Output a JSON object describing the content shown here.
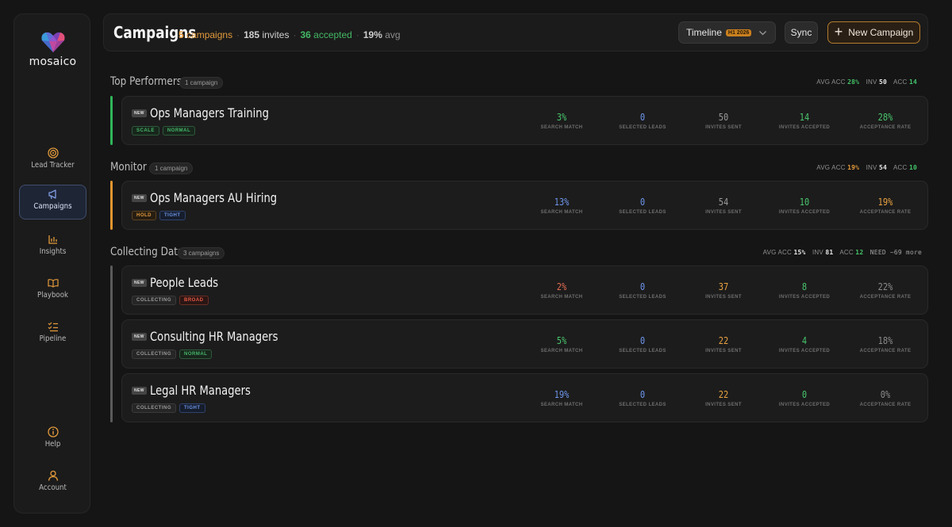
{
  "app": {
    "name": "mosaico"
  },
  "sidebar": {
    "items": [
      {
        "id": "lead-tracker",
        "label": "Lead Tracker",
        "icon": "target-icon",
        "active": false
      },
      {
        "id": "campaigns",
        "label": "Campaigns",
        "icon": "megaphone-icon",
        "active": true
      },
      {
        "id": "insights",
        "label": "Insights",
        "icon": "bar-chart-icon",
        "active": false
      },
      {
        "id": "playbook",
        "label": "Playbook",
        "icon": "book-icon",
        "active": false
      },
      {
        "id": "pipeline",
        "label": "Pipeline",
        "icon": "checklist-icon",
        "active": false
      },
      {
        "id": "help",
        "label": "Help",
        "icon": "info-icon",
        "active": false
      },
      {
        "id": "account",
        "label": "Account",
        "icon": "user-icon",
        "active": false
      }
    ]
  },
  "header": {
    "title": "Campaigns",
    "campaigns_num": "5",
    "campaigns_word": "campaigns",
    "invites_num": "185",
    "invites_word": "invites",
    "accepted_num": "36",
    "accepted_word": "accepted",
    "avg_num": "19%",
    "avg_word": "avg",
    "timeline_label": "Timeline",
    "timeline_badge": "H1 2026",
    "sync_label": "Sync",
    "new_campaign_label": "New Campaign"
  },
  "metric_captions": {
    "search_match": "SEARCH MATCH",
    "selected_leads": "SELECTED LEADS",
    "invites_sent": "INVITES SENT",
    "invites_accepted": "INVITES ACCEPTED",
    "acceptance_rate": "ACCEPTANCE RATE"
  },
  "sections": [
    {
      "title": "Top Performers",
      "pill": "1 campaign",
      "summary": {
        "avg_acc_label": "AVG ACC",
        "avg_acc": "28%",
        "inv_label": "INV",
        "inv": "50",
        "acc_label": "ACC",
        "acc": "14"
      },
      "campaigns": [
        {
          "badge": "NEW",
          "name": "Ops Managers Training",
          "tags": [
            "SCALE",
            "NORMAL"
          ],
          "search_match": "3%",
          "selected_leads": "0",
          "invites_sent": "50",
          "invites_accepted": "14",
          "acceptance_rate": "28%"
        }
      ]
    },
    {
      "title": "Monitor",
      "pill": "1 campaign",
      "summary": {
        "avg_acc_label": "AVG ACC",
        "avg_acc": "19%",
        "inv_label": "INV",
        "inv": "54",
        "acc_label": "ACC",
        "acc": "10"
      },
      "campaigns": [
        {
          "badge": "NEW",
          "name": "Ops Managers AU Hiring",
          "tags": [
            "HOLD",
            "TIGHT"
          ],
          "search_match": "13%",
          "selected_leads": "0",
          "invites_sent": "54",
          "invites_accepted": "10",
          "acceptance_rate": "19%"
        }
      ]
    },
    {
      "title": "Collecting Data",
      "pill": "3 campaigns",
      "summary": {
        "avg_acc_label": "AVG ACC",
        "avg_acc": "15%",
        "inv_label": "INV",
        "inv": "81",
        "acc_label": "ACC",
        "acc": "12",
        "need": "NEED ~69 more"
      },
      "campaigns": [
        {
          "badge": "NEW",
          "name": "People Leads",
          "tags": [
            "COLLECTING",
            "BROAD"
          ],
          "search_match": "2%",
          "selected_leads": "0",
          "invites_sent": "37",
          "invites_accepted": "8",
          "acceptance_rate": "22%"
        },
        {
          "badge": "NEW",
          "name": "Consulting HR Managers",
          "tags": [
            "COLLECTING",
            "NORMAL"
          ],
          "search_match": "5%",
          "selected_leads": "0",
          "invites_sent": "22",
          "invites_accepted": "4",
          "acceptance_rate": "18%"
        },
        {
          "badge": "NEW",
          "name": "Legal HR Managers",
          "tags": [
            "COLLECTING",
            "TIGHT"
          ],
          "search_match": "19%",
          "selected_leads": "0",
          "invites_sent": "22",
          "invites_accepted": "0",
          "acceptance_rate": "0%"
        }
      ]
    }
  ],
  "colors": {
    "accent_orange": "#e39a3b",
    "accent_green": "#43b865",
    "accent_blue": "#6d95ea",
    "top_bar": "#2fb55a",
    "monitor_bar": "#e2952f",
    "collecting_bar": "#5a5a5a"
  }
}
